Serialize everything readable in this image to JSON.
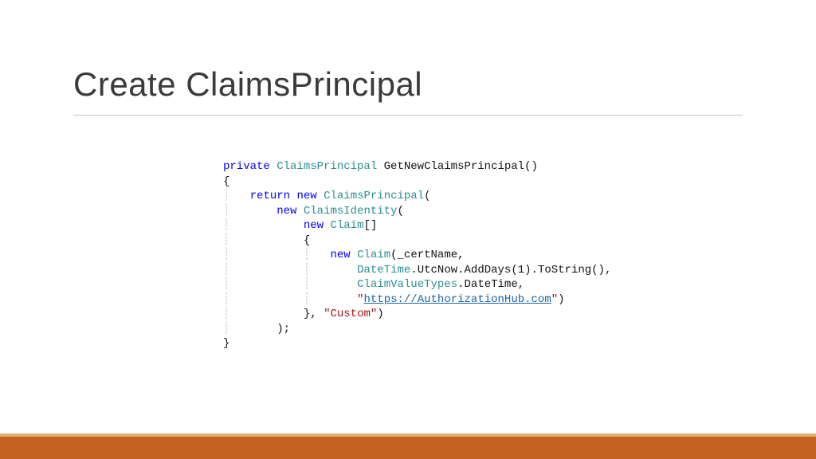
{
  "title": "Create ClaimsPrincipal",
  "code": {
    "l1_kw_private": "private",
    "l1_typ_cp": "ClaimsPrincipal",
    "l1_method": "GetNewClaimsPrincipal()",
    "l2_brace": "{",
    "l3_kw_return": "return",
    "l3_kw_new": "new",
    "l3_typ_cp": "ClaimsPrincipal",
    "l3_paren": "(",
    "l4_kw_new": "new",
    "l4_typ_ci": "ClaimsIdentity",
    "l4_paren": "(",
    "l5_kw_new": "new",
    "l5_typ_claim": "Claim",
    "l5_brackets": "[]",
    "l6_brace": "{",
    "l7_kw_new": "new",
    "l7_typ_claim": "Claim",
    "l7_args": "(_certName,",
    "l8_typ_dt": "DateTime",
    "l8_rest": ".UtcNow.AddDays(1).ToString(),",
    "l9_typ_cvt": "ClaimValueTypes",
    "l9_rest": ".DateTime,",
    "l10_q1": "\"",
    "l10_url": "https://AuthorizationHub.com",
    "l10_q2": "\"",
    "l10_paren": ")",
    "l11_brace_comma": "}, ",
    "l11_str_custom": "\"Custom\"",
    "l11_paren": ")",
    "l12_close": ");",
    "l13_brace": "}"
  },
  "colors": {
    "accent_main": "#c46321",
    "accent_light": "#e0ad71"
  }
}
